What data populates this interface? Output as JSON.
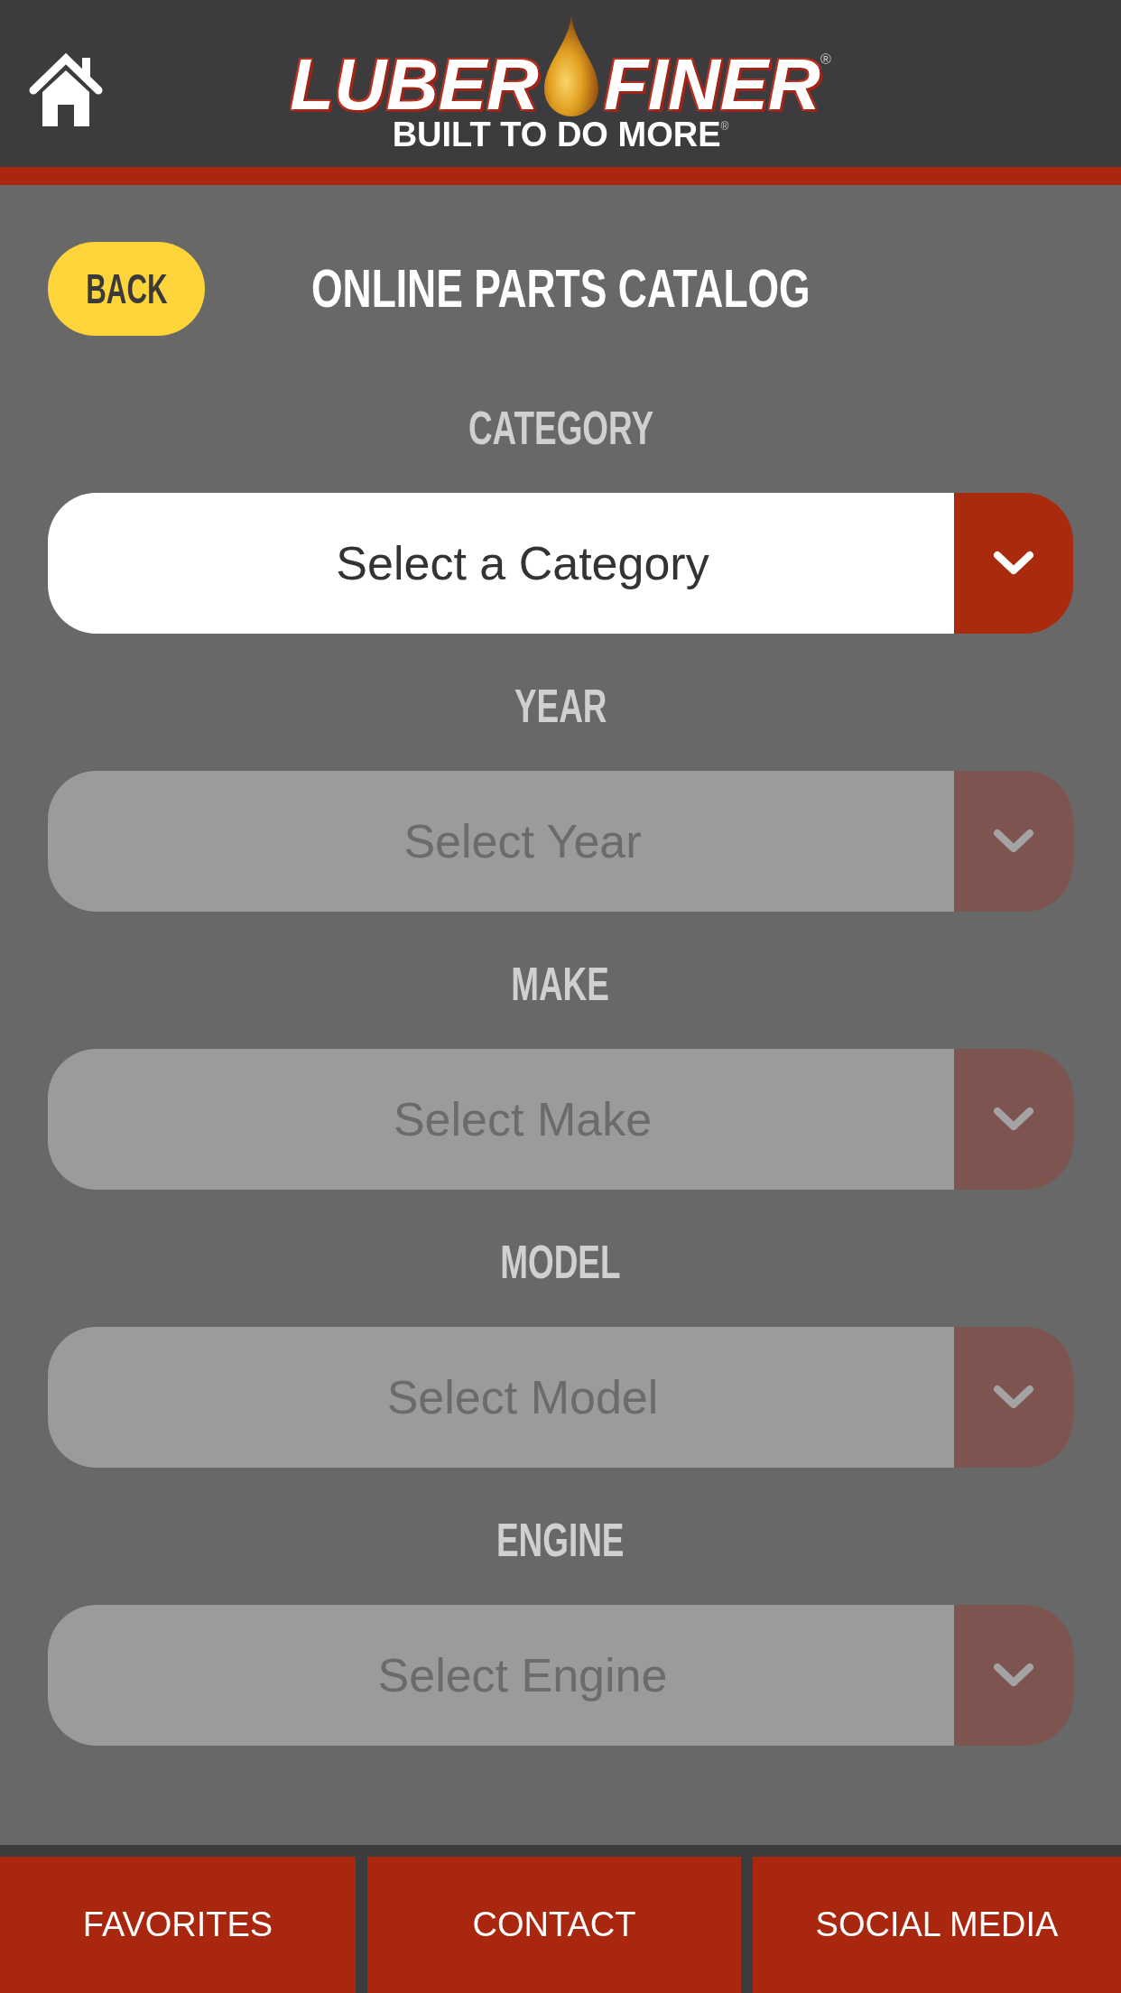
{
  "header": {
    "logo": {
      "word_left": "LUBER",
      "word_right": "FINER",
      "registered_mark": "®",
      "tagline": "BUILT TO DO MORE",
      "tagline_mark": "®"
    }
  },
  "toolbar": {
    "back_button": "BACK",
    "title": "ONLINE PARTS CATALOG"
  },
  "fields": [
    {
      "label": "CATEGORY",
      "placeholder": "Select a Category",
      "disabled": false
    },
    {
      "label": "YEAR",
      "placeholder": "Select Year",
      "disabled": true
    },
    {
      "label": "MAKE",
      "placeholder": "Select Make",
      "disabled": true
    },
    {
      "label": "MODEL",
      "placeholder": "Select Model",
      "disabled": true
    },
    {
      "label": "ENGINE",
      "placeholder": "Select Engine",
      "disabled": true
    }
  ],
  "bottom_nav": [
    "FAVORITES",
    "CONTACT",
    "SOCIAL MEDIA"
  ]
}
